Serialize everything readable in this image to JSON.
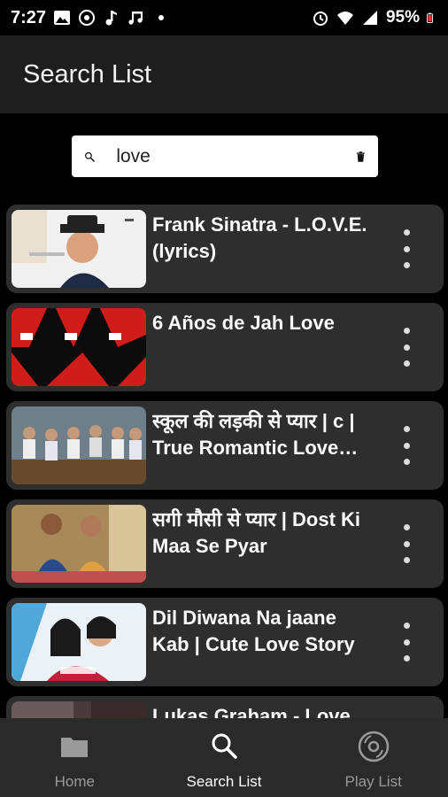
{
  "status_bar": {
    "time": "7:27",
    "battery": "95%"
  },
  "app_bar": {
    "title": "Search List"
  },
  "search": {
    "value": "love",
    "placeholder": ""
  },
  "results": [
    {
      "title": "Frank Sinatra - L.O.V.E. (lyrics)"
    },
    {
      "title": "6 Años de Jah Love"
    },
    {
      "title": "स्कूल की लड़की से प्यार | c | True Romantic Love Story"
    },
    {
      "title": "सगी मौसी से प्यार | Dost Ki Maa Se Pyar"
    },
    {
      "title": "Dil Diwana Na jaane Kab | Cute Love Story"
    },
    {
      "title": "Lukas Graham - Love"
    }
  ],
  "bottom_nav": {
    "home": "Home",
    "search": "Search List",
    "playlist": "Play List"
  },
  "colors": {
    "background": "#000000",
    "app_bar": "#1e1e1e",
    "card": "#2e2e2e",
    "nav": "#2a2a2a",
    "inactive": "#9a9a9a"
  },
  "icons": {
    "search": "search-icon",
    "trash": "trash-icon",
    "more": "more-vert-icon",
    "home": "folder-icon",
    "playlist": "disc-icon"
  }
}
